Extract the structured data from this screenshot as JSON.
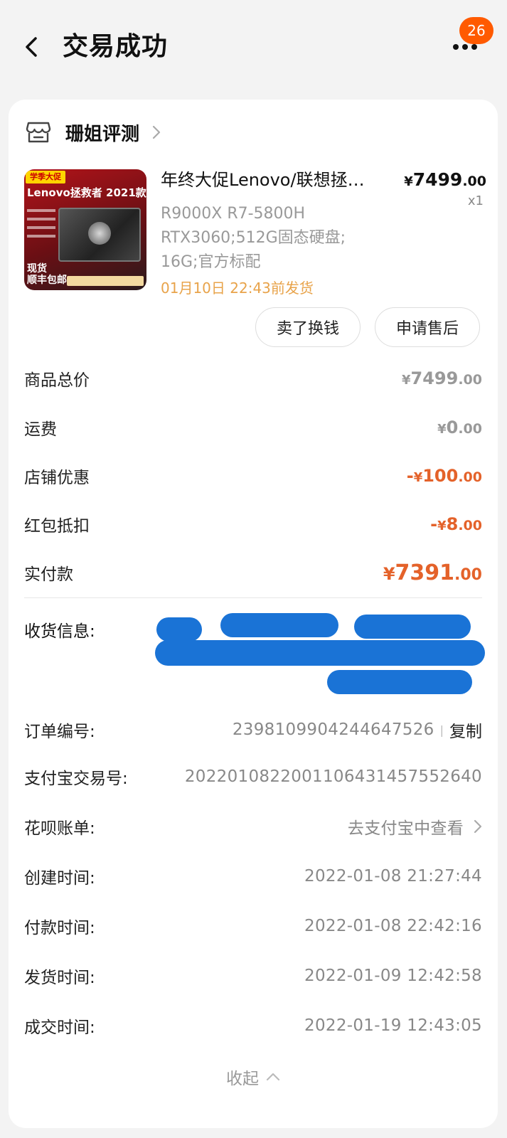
{
  "header": {
    "title": "交易成功",
    "badge_count": "26",
    "back_icon": "chevron-left-icon",
    "more_icon": "more-dots-icon"
  },
  "shop": {
    "name": "珊姐评测",
    "icon": "store-icon"
  },
  "product": {
    "title": "年终大促Lenovo/联想拯…",
    "price_currency": "¥",
    "price_int": "7499",
    "price_cents": ".00",
    "quantity": "x1",
    "spec": "R9000X R7-5800H\nRTX3060;512G固态硬盘;\n16G;官方标配",
    "ship_note": "01月10日 22:43前发货",
    "thumb": {
      "tag": "学季大促",
      "title": "Lenovo拯救者 2021款",
      "stock_line1": "现货",
      "stock_line2": "顺丰包邮"
    }
  },
  "actions": {
    "sell": "卖了换钱",
    "after_sale": "申请售后"
  },
  "price_rows": [
    {
      "label": "商品总价",
      "sign": "",
      "cur": "¥",
      "int": "7499",
      "cents": ".00"
    },
    {
      "label": "运费",
      "sign": "",
      "cur": "¥",
      "int": "0",
      "cents": ".00"
    },
    {
      "label": "店铺优惠",
      "sign": "-",
      "cur": "¥",
      "int": "100",
      "cents": ".00"
    },
    {
      "label": "红包抵扣",
      "sign": "-",
      "cur": "¥",
      "int": "8",
      "cents": ".00"
    },
    {
      "label": "实付款",
      "sign": "",
      "cur": "¥",
      "int": "7391",
      "cents": ".00"
    }
  ],
  "address": {
    "label": "收货信息:"
  },
  "order_info": {
    "order_no_label": "订单编号:",
    "order_no": "2398109904244647526",
    "copy_label": "复制",
    "alipay_label": "支付宝交易号:",
    "alipay_no": "2022010822001106431457552640",
    "huabei_label": "花呗账单:",
    "huabei_link": "去支付宝中查看",
    "created_label": "创建时间:",
    "created": "2022-01-08 21:27:44",
    "paid_label": "付款时间:",
    "paid": "2022-01-08 22:42:16",
    "shipped_label": "发货时间:",
    "shipped": "2022-01-09 12:42:58",
    "completed_label": "成交时间:",
    "completed": "2022-01-19 12:43:05"
  },
  "collapse_label": "收起",
  "colors": {
    "accent": "#e4622a",
    "badge": "#ff5a00",
    "ship_note": "#e8a34a",
    "redaction": "#1a73d6"
  }
}
